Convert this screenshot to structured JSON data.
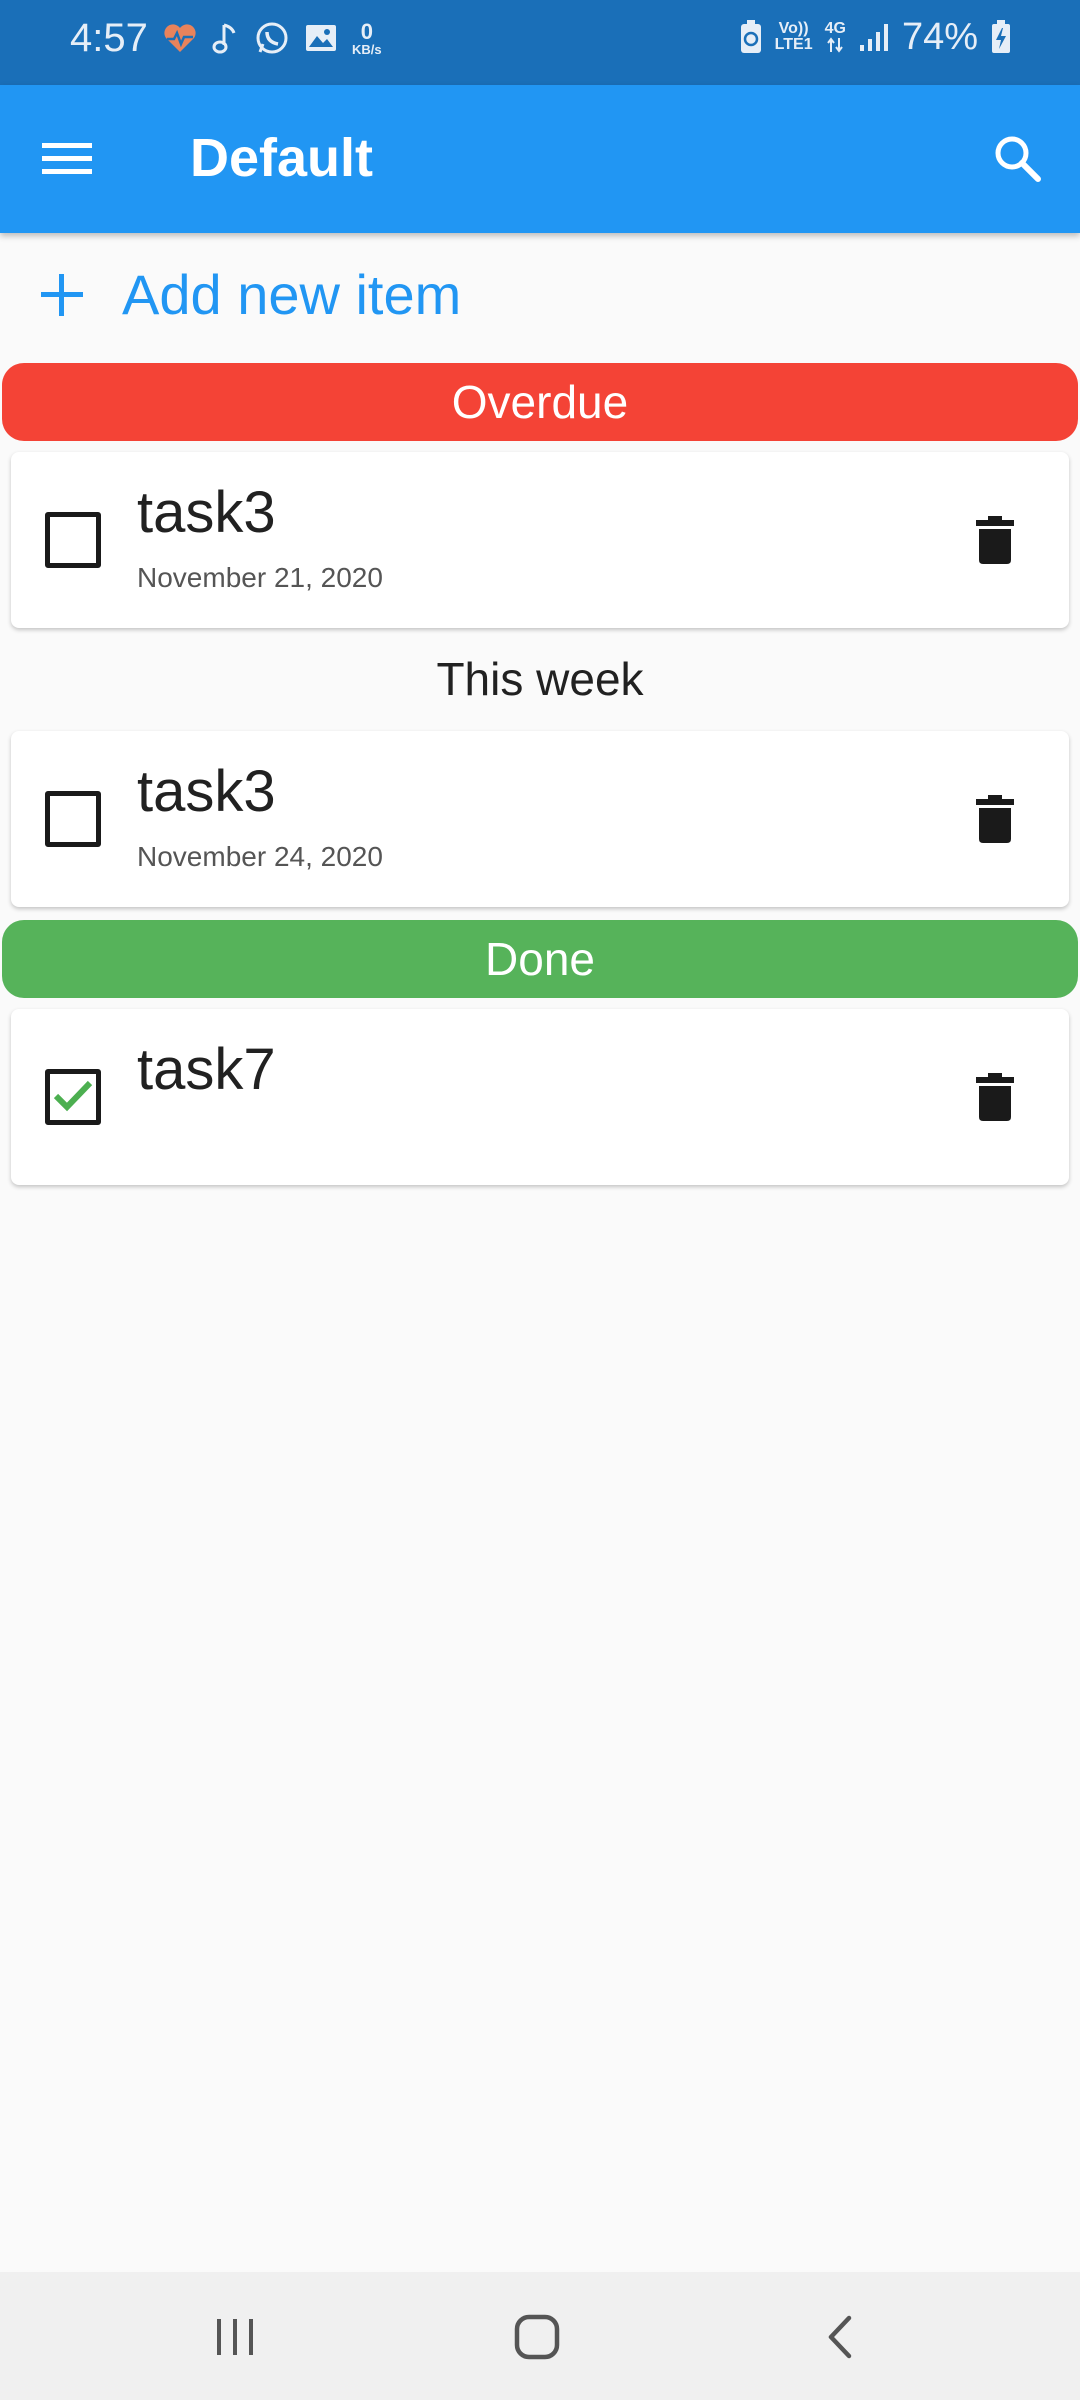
{
  "status_bar": {
    "time": "4:57",
    "network_speed_value": "0",
    "network_speed_unit": "KB/s",
    "volte_top": "Vo))",
    "volte_bottom": "LTE1",
    "network_type": "4G",
    "battery_percent": "74%",
    "icons": [
      "heart-rate-icon",
      "music-note-icon",
      "whatsapp-icon",
      "image-icon",
      "battery-saver-icon",
      "signal-icon",
      "battery-charging-icon"
    ]
  },
  "app_bar": {
    "title": "Default",
    "icons": [
      "menu-icon",
      "search-icon"
    ],
    "color": "#2196f3"
  },
  "add_item": {
    "label": "Add new item",
    "icon": "plus-icon"
  },
  "sections": [
    {
      "label": "Overdue",
      "color": "#f44336",
      "tasks": [
        {
          "title": "task3",
          "date": "November 21, 2020",
          "checked": false
        }
      ]
    },
    {
      "label": "This week",
      "tasks": [
        {
          "title": "task3",
          "date": "November 24, 2020",
          "checked": false
        }
      ]
    },
    {
      "label": "Done",
      "color": "#56b35a",
      "tasks": [
        {
          "title": "task7",
          "date": "",
          "checked": true
        }
      ]
    }
  ],
  "task_icons": [
    "checkbox-icon",
    "trash-icon"
  ],
  "nav_bar": {
    "icons": [
      "recents-icon",
      "home-icon",
      "back-icon"
    ]
  }
}
